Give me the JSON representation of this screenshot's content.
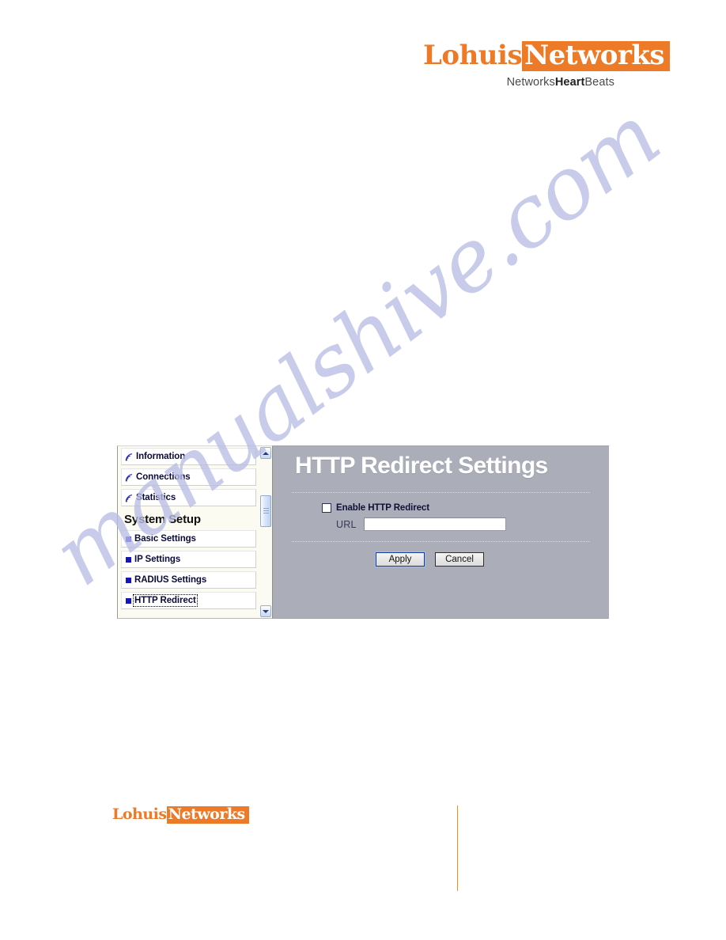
{
  "watermark": {
    "text": "manualshive.com"
  },
  "header": {
    "logo": {
      "part1": "Lohuis",
      "part2": "Networks",
      "tagline_prefix": "Networks",
      "tagline_bold": "Heart",
      "tagline_suffix": "Beats"
    }
  },
  "footer": {
    "logo": {
      "part1": "Lohuis",
      "part2": "Networks"
    }
  },
  "screenshot": {
    "nav": {
      "top_items": [
        {
          "label": "Information",
          "icon": "wave-icon"
        },
        {
          "label": "Connections",
          "icon": "wave-icon"
        },
        {
          "label": "Statistics",
          "icon": "wave-icon"
        }
      ],
      "section_heading": "System Setup",
      "setup_items": [
        {
          "label": "Basic Settings",
          "icon": "blue-square-icon",
          "focused": false
        },
        {
          "label": "IP Settings",
          "icon": "blue-square-icon",
          "focused": false
        },
        {
          "label": "RADIUS Settings",
          "icon": "blue-square-icon",
          "focused": false
        },
        {
          "label": "HTTP Redirect",
          "icon": "blue-square-icon",
          "focused": true
        }
      ],
      "scrollbar": {
        "up_arrow": "scroll-up-icon",
        "down_arrow": "scroll-down-icon"
      }
    },
    "panel": {
      "title": "HTTP Redirect Settings",
      "checkbox_label": "Enable HTTP Redirect",
      "checkbox_checked": false,
      "url_label": "URL",
      "url_value": "",
      "url_placeholder": "",
      "apply_label": "Apply",
      "cancel_label": "Cancel"
    }
  },
  "colors": {
    "brand_orange": "#ec7a26",
    "panel_gray": "#abadb9",
    "bullet_blue": "#1515b8",
    "watermark_lavender": "#b9bde4",
    "footer_rule_orange": "#e8921f"
  }
}
